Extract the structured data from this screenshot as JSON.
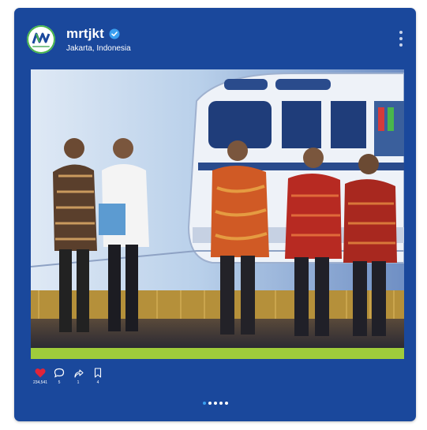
{
  "post": {
    "username": "mrtjkt",
    "location": "Jakarta, Indonesia",
    "verified": true,
    "avatar_logo": "mrt-jakarta-logo",
    "image_description": "five officials in batik and white shirts shaking hands and holding a book in front of an MRT train backdrop"
  },
  "actions": {
    "likes": "234,541",
    "comments": "5",
    "shares": "1",
    "saves": "4"
  },
  "carousel": {
    "total": 5,
    "active_index": 0
  },
  "colors": {
    "card_background": "#1a489c",
    "like_heart": "#e0243a",
    "active_dot": "#3a9ff0",
    "verified_badge": "#3a9ff0",
    "photo_bottom_bar": "#9fcc3b"
  },
  "icons": [
    "more-vertical-icon",
    "heart-icon",
    "comment-icon",
    "share-icon",
    "bookmark-icon",
    "verified-icon"
  ]
}
